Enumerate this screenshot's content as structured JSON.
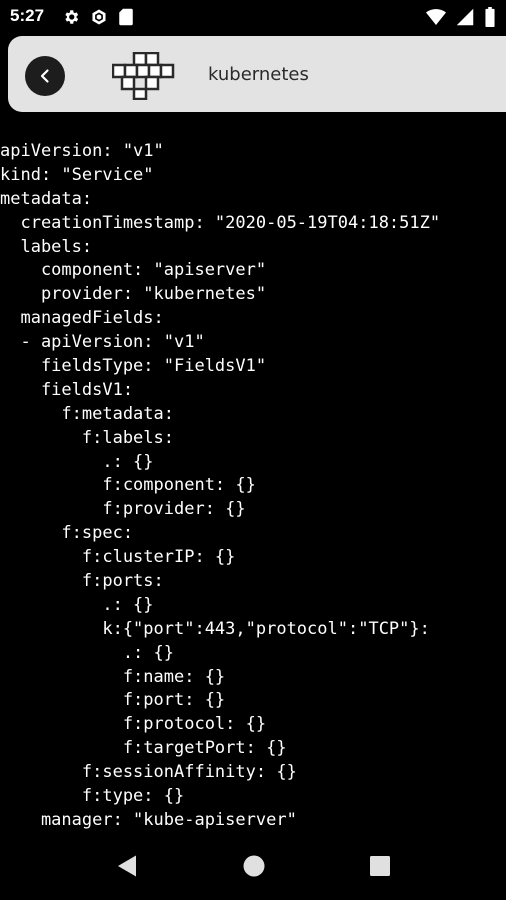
{
  "status_bar": {
    "time": "5:27",
    "left_icons": [
      "gear-icon",
      "hexagon-icon",
      "sim-card-icon"
    ],
    "right_icons": [
      "wifi-icon",
      "signal-icon",
      "battery-icon"
    ]
  },
  "app_bar": {
    "back_icon": "chevron-left-icon",
    "logo_icon": "kubernetes-block-logo",
    "title": "kubernetes",
    "background": "#e3e3e3"
  },
  "yaml_lines": [
    "apiVersion: \"v1\"",
    "kind: \"Service\"",
    "metadata:",
    "  creationTimestamp: \"2020-05-19T04:18:51Z\"",
    "  labels:",
    "    component: \"apiserver\"",
    "    provider: \"kubernetes\"",
    "  managedFields:",
    "  - apiVersion: \"v1\"",
    "    fieldsType: \"FieldsV1\"",
    "    fieldsV1:",
    "      f:metadata:",
    "        f:labels:",
    "          .: {}",
    "          f:component: {}",
    "          f:provider: {}",
    "      f:spec:",
    "        f:clusterIP: {}",
    "        f:ports:",
    "          .: {}",
    "          k:{\"port\":443,\"protocol\":\"TCP\"}:",
    "            .: {}",
    "            f:name: {}",
    "            f:port: {}",
    "            f:protocol: {}",
    "            f:targetPort: {}",
    "        f:sessionAffinity: {}",
    "        f:type: {}",
    "    manager: \"kube-apiserver\""
  ],
  "nav_bar": {
    "buttons": [
      "back-triangle-icon",
      "home-circle-icon",
      "recents-square-icon"
    ]
  }
}
